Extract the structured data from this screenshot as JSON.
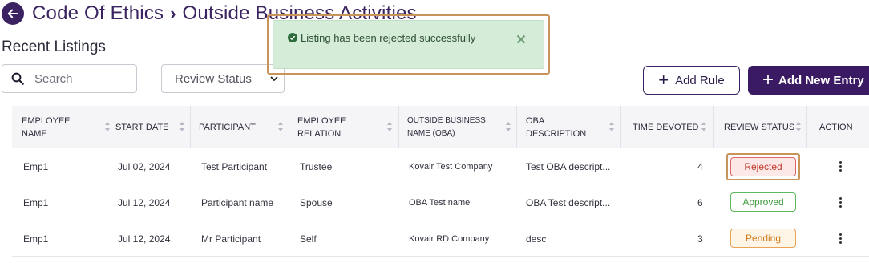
{
  "header": {
    "breadcrumb_parent": "Code Of Ethics",
    "breadcrumb_current": "Outside Business Activities"
  },
  "subtitle": "Recent Listings",
  "search": {
    "placeholder": "Search"
  },
  "filter": {
    "selected": "Review Status"
  },
  "buttons": {
    "add_rule": "Add Rule",
    "add_entry": "Add New Entry"
  },
  "toast": {
    "message": "Listing has been rejected successfully"
  },
  "table": {
    "columns": [
      "EMPLOYEE NAME",
      "START DATE",
      "PARTICIPANT",
      "EMPLOYEE RELATION",
      "OUTSIDE BUSINESS NAME (OBA)",
      "OBA DESCRIPTION",
      "TIME DEVOTED",
      "REVIEW STATUS",
      "ACTION"
    ],
    "rows": [
      {
        "employee": "Emp1",
        "start_date": "Jul 02, 2024",
        "participant": "Test Participant",
        "relation": "Trustee",
        "oba_name": "Kovair Test Company",
        "oba_desc": "Test OBA descript...",
        "time": "4",
        "status": "Rejected"
      },
      {
        "employee": "Emp1",
        "start_date": "Jul 12, 2024",
        "participant": "Participant name",
        "relation": "Spouse",
        "oba_name": "OBA Test name",
        "oba_desc": "OBA Test descript...",
        "time": "6",
        "status": "Approved"
      },
      {
        "employee": "Emp1",
        "start_date": "Jul 12, 2024",
        "participant": "Mr Participant",
        "relation": "Self",
        "oba_name": "Kovair RD Company",
        "oba_desc": "desc",
        "time": "3",
        "status": "Pending"
      }
    ]
  },
  "colors": {
    "brand": "#3a1a63",
    "rejected": "#e06666",
    "approved": "#5cb85c",
    "pending": "#e8a355"
  }
}
